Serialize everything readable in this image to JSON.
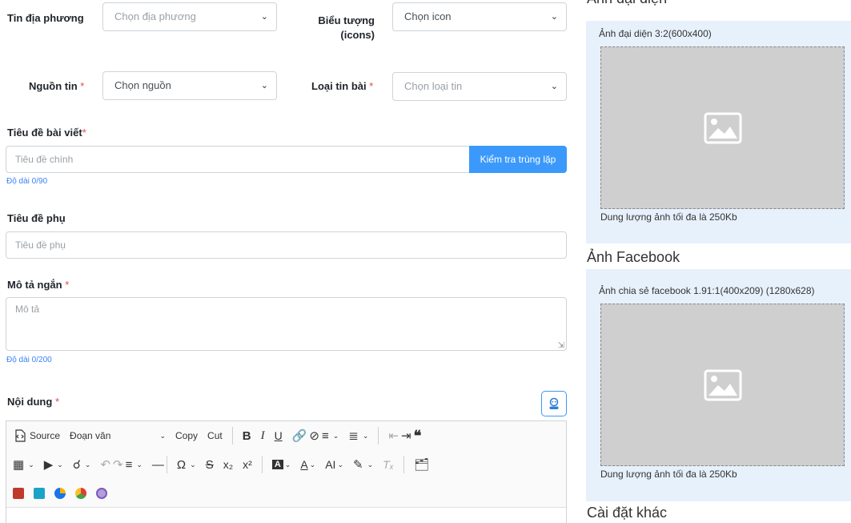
{
  "form": {
    "local_news": {
      "label": "Tin địa phương",
      "placeholder": "Chọn địa phương"
    },
    "icons": {
      "label_line1": "Biểu tượng",
      "label_line2": "(icons)",
      "value": "Chọn icon"
    },
    "source": {
      "label": "Nguồn tin",
      "required": "*",
      "value": "Chọn nguồn"
    },
    "article_type": {
      "label": "Loại tin bài",
      "required": "*",
      "placeholder": "Chọn loại tin"
    },
    "title": {
      "label": "Tiêu đề bài viết",
      "required": "*",
      "placeholder": "Tiêu đề chính",
      "check_button": "Kiểm tra trùng lặp",
      "length": "Độ dài 0/90"
    },
    "subtitle": {
      "label": "Tiêu đề phụ",
      "placeholder": "Tiêu đề phụ"
    },
    "summary": {
      "label": "Mô tả ngắn",
      "required": "*",
      "placeholder": "Mô tả",
      "length": "Độ dài 0/200"
    },
    "content": {
      "label": "Nội dung",
      "required": "*"
    }
  },
  "editor": {
    "source_label": "Source",
    "paragraph_label": "Đoạn văn",
    "copy_label": "Copy",
    "cut_label": "Cut",
    "bold": "B",
    "italic": "I",
    "underline": "U",
    "subscript": "x₂",
    "superscript": "x²",
    "omega": "Ω",
    "strike": "S",
    "highlight_text": "A",
    "font_size": "AI",
    "quote": "❝"
  },
  "avatar_panel": {
    "section_title": "Ảnh đại diện",
    "required": "*",
    "caption": "Ảnh đại diện 3:2(600x400)",
    "size_note": "Dung lượng ảnh tối đa là 250Kb"
  },
  "facebook_panel": {
    "section_title": "Ảnh Facebook",
    "caption": "Ảnh chia sẻ facebook 1.91:1(400x209) (1280x628)",
    "size_note": "Dung lượng ảnh tối đa là 250Kb"
  },
  "other_settings": {
    "section_title": "Cài đặt khác"
  },
  "colors": {
    "primary": "#3b99fc",
    "required": "#e5484d",
    "panel_bg": "#e7f1fc"
  }
}
